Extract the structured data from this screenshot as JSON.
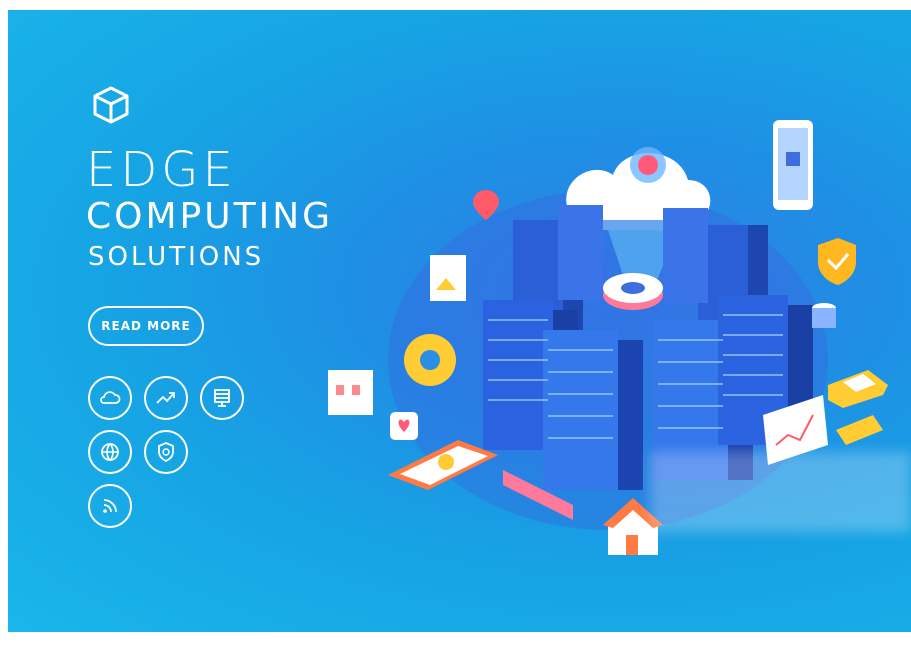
{
  "hero": {
    "title_line1": "EDGE",
    "title_line2": "COMPUTING",
    "title_line3": "SOLUTIONS",
    "cta_label": "READ MORE"
  },
  "feature_icons": [
    "cloud-icon",
    "trending-up-icon",
    "server-monitor-icon",
    "globe-icon",
    "shield-icon",
    "rss-icon"
  ],
  "colors": {
    "background": "#16a4e4",
    "text": "#ffffff",
    "server_blue": "#2a5fd8",
    "accent_orange": "#ff7a45",
    "accent_yellow": "#ffcc33",
    "accent_pink": "#ff6fa0"
  }
}
